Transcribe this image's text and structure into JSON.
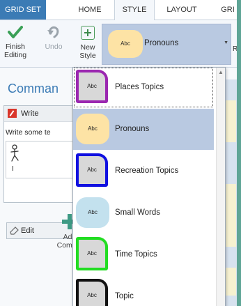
{
  "tabs": [
    {
      "label": "GRID SET"
    },
    {
      "label": "HOME"
    },
    {
      "label": "STYLE"
    },
    {
      "label": "LAYOUT"
    },
    {
      "label": "GRI"
    }
  ],
  "ribbon": {
    "finish_line1": "Finish",
    "finish_line2": "Editing",
    "undo": "Undo",
    "new_line1": "New",
    "new_line2": "Style",
    "selected_style": {
      "chip": "Abc",
      "name": "Pronouns"
    },
    "trailing_label": "R"
  },
  "sidebar": {
    "title": "Comman",
    "command": {
      "title": "Write",
      "description": "Write some te",
      "symbol_label": "I",
      "edit_label": "Edit"
    },
    "add_line1": "Add",
    "add_line2": "Comma"
  },
  "dropdown": {
    "items": [
      {
        "chip": "Abc",
        "name": "Places Topics",
        "shape": "folder",
        "border": "#9b27b0",
        "fill": "#d8d8d8",
        "selected": false,
        "focused": true
      },
      {
        "chip": "Abc",
        "name": "Pronouns",
        "shape": "pill",
        "border": "",
        "fill": "#fde3a5",
        "selected": true,
        "focused": false
      },
      {
        "chip": "Abc",
        "name": "Recreation Topics",
        "shape": "folder",
        "border": "#1010e0",
        "fill": "#d8d8d8",
        "selected": false,
        "focused": false
      },
      {
        "chip": "Abc",
        "name": "Small Words",
        "shape": "pill",
        "border": "",
        "fill": "#c3e1ee",
        "selected": false,
        "focused": false
      },
      {
        "chip": "Abc",
        "name": "Time Topics",
        "shape": "folder",
        "border": "#22dd22",
        "fill": "#d8d8d8",
        "selected": false,
        "focused": false
      },
      {
        "chip": "Abc",
        "name": "Topic",
        "shape": "folder",
        "border": "#111111",
        "fill": "#d8d8d8",
        "selected": false,
        "focused": false
      }
    ]
  },
  "colors": {
    "accent": "#3b7bb5",
    "selection": "#b9c9e1",
    "window_edge": "#5fa596"
  }
}
